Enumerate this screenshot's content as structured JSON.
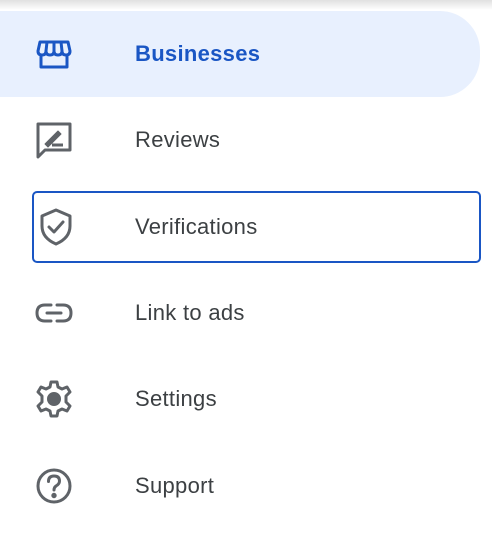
{
  "colors": {
    "accent": "#1a56c4",
    "active_background": "#e8f0fe",
    "text": "#3c4043",
    "icon": "#5f6368"
  },
  "nav": {
    "items": [
      {
        "label": "Businesses",
        "icon": "storefront-icon",
        "state": "selected"
      },
      {
        "label": "Reviews",
        "icon": "rate-review-icon",
        "state": "normal"
      },
      {
        "label": "Verifications",
        "icon": "verified-shield-icon",
        "state": "focused"
      },
      {
        "label": "Link to ads",
        "icon": "link-icon",
        "state": "normal"
      },
      {
        "label": "Settings",
        "icon": "gear-icon",
        "state": "normal"
      },
      {
        "label": "Support",
        "icon": "help-circle-icon",
        "state": "normal"
      }
    ]
  }
}
